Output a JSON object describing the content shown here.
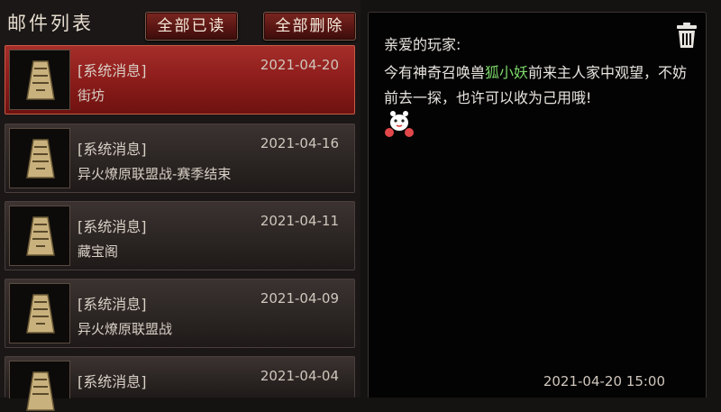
{
  "left_panel": {
    "title": "邮件列表",
    "read_all_label": "全部已读",
    "delete_all_label": "全部删除",
    "mails": [
      {
        "tag": "[系统消息]",
        "title": "街坊",
        "date": "2021-04-20",
        "selected": true
      },
      {
        "tag": "[系统消息]",
        "title": "异火燎原联盟战-赛季结束",
        "date": "2021-04-16",
        "selected": false
      },
      {
        "tag": "[系统消息]",
        "title": "藏宝阁",
        "date": "2021-04-11",
        "selected": false
      },
      {
        "tag": "[系统消息]",
        "title": "异火燎原联盟战",
        "date": "2021-04-09",
        "selected": false
      },
      {
        "tag": "[系统消息]",
        "title": "",
        "date": "2021-04-04",
        "selected": false
      }
    ]
  },
  "detail": {
    "greeting": "亲爱的玩家:",
    "message_before": "今有神奇召唤兽",
    "pet_name": "狐小妖",
    "message_after": "前来主人家中观望，不妨前去一探，也许可以收为己用哦!",
    "timestamp": "2021-04-20 15:00",
    "trash_icon": "trash-icon",
    "emoji_icon": "white-creature-emoji"
  },
  "colors": {
    "selected_item": "#8f1e1c",
    "highlight_text": "#7dd86b",
    "panel_background": "#030303"
  }
}
